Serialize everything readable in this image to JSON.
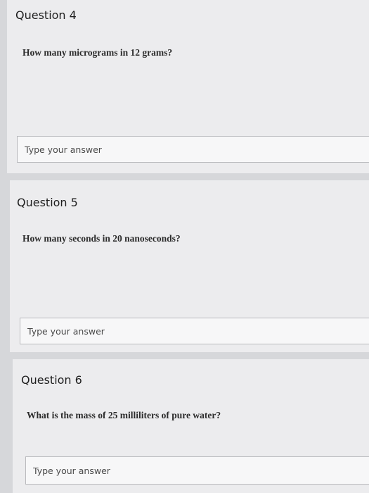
{
  "questions": [
    {
      "title": "Question 4",
      "text": "How many micrograms in 12 grams?",
      "answer_placeholder": "Type your answer",
      "answer_value": ""
    },
    {
      "title": "Question 5",
      "text": "How many seconds in 20 nanoseconds?",
      "answer_placeholder": "Type your answer",
      "answer_value": ""
    },
    {
      "title": "Question 6",
      "text": "What is the mass of 25 milliliters of pure water?",
      "answer_placeholder": "Type your answer",
      "answer_value": ""
    }
  ]
}
